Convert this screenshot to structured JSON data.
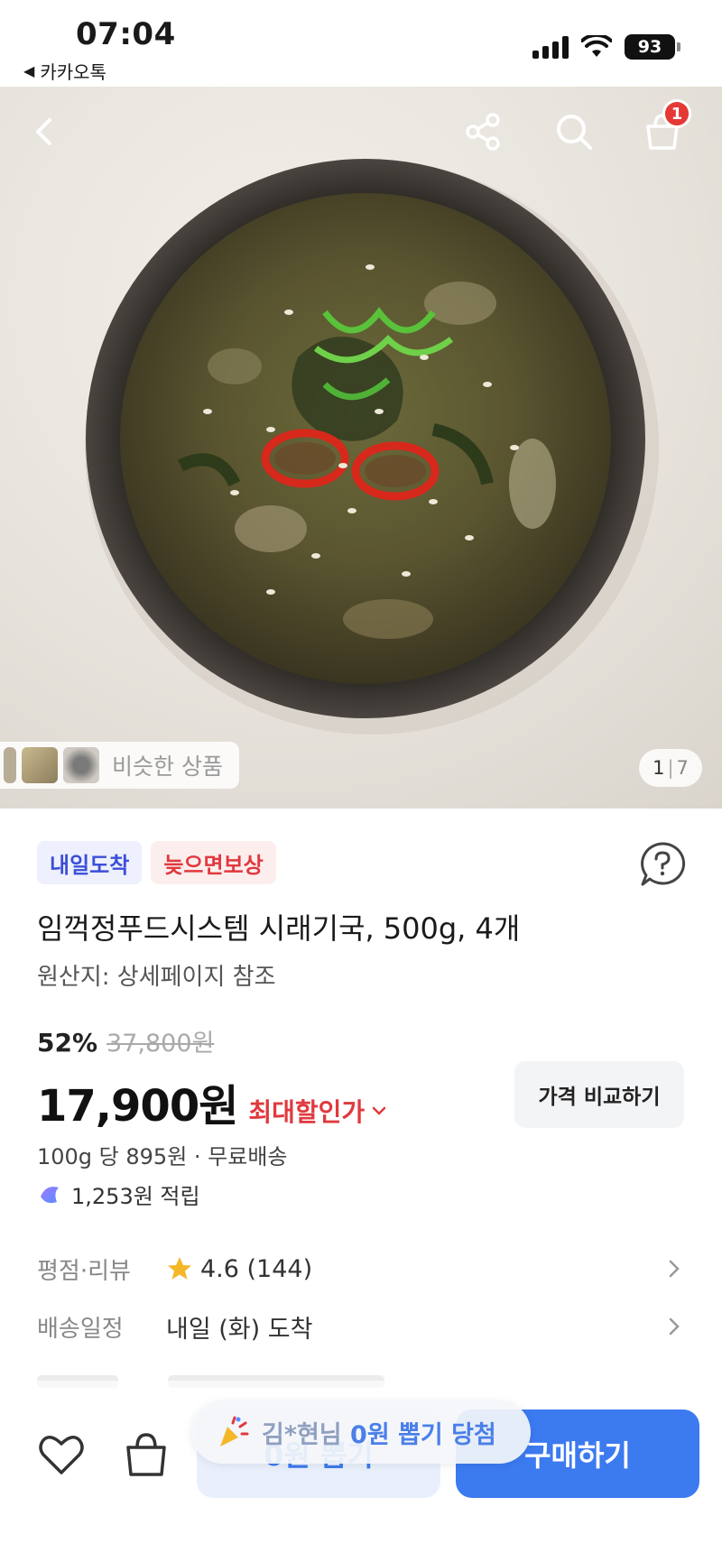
{
  "status_bar": {
    "time": "07:04",
    "back_app": "카카오톡",
    "battery": "93"
  },
  "hero": {
    "similar_label": "비슷한 상품",
    "pager_current": "1",
    "pager_total": "7",
    "cart_badge": "1"
  },
  "product": {
    "badges": [
      "내일도착",
      "늦으면보상"
    ],
    "title": "임꺽정푸드시스템 시래기국, 500g, 4개",
    "origin": "원산지: 상세페이지 참조",
    "discount_rate": "52%",
    "original_price": "37,800원",
    "price": "17,900원",
    "max_discount_label": "최대할인가",
    "compare_button": "가격 비교하기",
    "unit_price": "100g 당 895원 · 무료배송",
    "points": "1,253원 적립"
  },
  "info_rows": {
    "rating_key": "평점·리뷰",
    "rating_value": "4.6 (144)",
    "delivery_key": "배송일정",
    "delivery_value": "내일 (화) 도착"
  },
  "bottom_bar": {
    "zero_draw_button": "0원 뽑기",
    "buy_button": "구매하기",
    "toast_name": "김*현님",
    "toast_rest": "0원 뽑기 당첨"
  },
  "colors": {
    "accent_blue": "#3c7af0",
    "discount_red": "#e0393e",
    "badge_blue": "#3b4fd8"
  }
}
